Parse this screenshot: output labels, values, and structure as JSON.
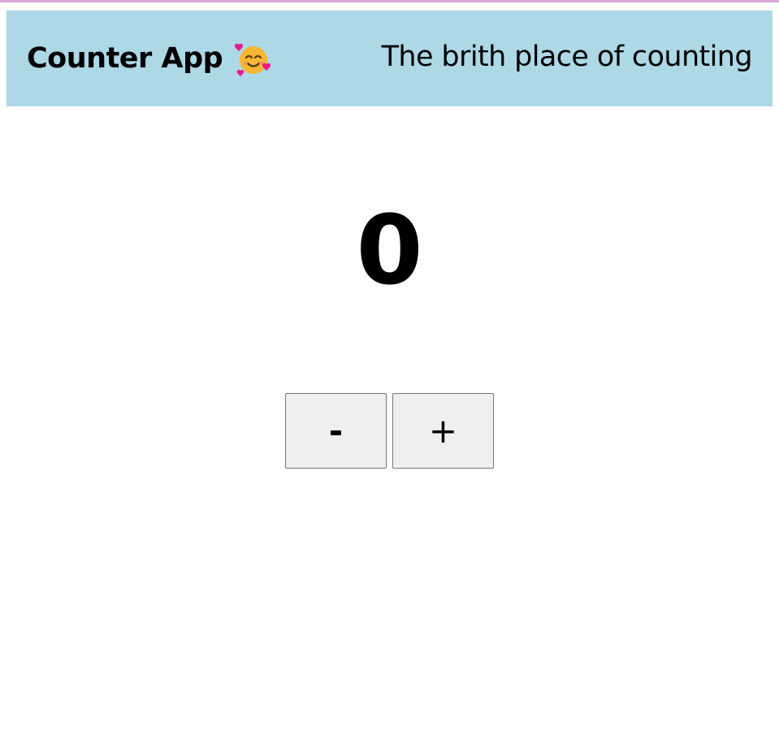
{
  "header": {
    "title": "Counter App",
    "emoji_icon": "smiling-face-with-hearts-icon",
    "tagline": "The brith place of counting",
    "background_color": "#add8e6"
  },
  "counter": {
    "value": "0"
  },
  "controls": {
    "decrement_label": "-",
    "increment_label": "+"
  }
}
